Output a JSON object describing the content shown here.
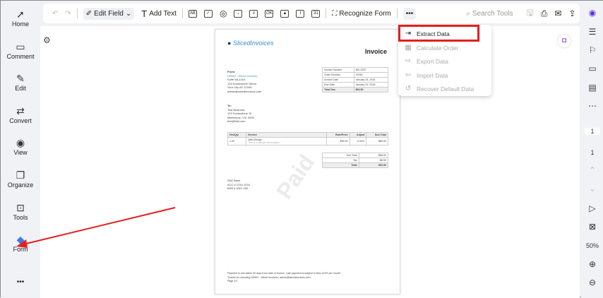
{
  "sidebar": {
    "items": [
      {
        "label": "Home",
        "icon": "rocket-icon"
      },
      {
        "label": "Comment",
        "icon": "comment-icon"
      },
      {
        "label": "Edit",
        "icon": "edit-icon"
      },
      {
        "label": "Convert",
        "icon": "convert-icon"
      },
      {
        "label": "View",
        "icon": "view-icon"
      },
      {
        "label": "Organize",
        "icon": "organize-icon"
      },
      {
        "label": "Tools",
        "icon": "toolbox-icon"
      },
      {
        "label": "Form",
        "icon": "form-icon"
      }
    ],
    "more": "•••"
  },
  "toolbar": {
    "edit_field": "Edit Field",
    "add_text": "Add Text",
    "recognize_form": "Recognize Form",
    "more": "•••",
    "search": "Search Tools",
    "ok_label": "OK",
    "date_label": "31",
    "text_field": "AB"
  },
  "dropdown": {
    "items": [
      "Extract Data",
      "Calculate Order",
      "Export Data",
      "Import Data",
      "Recover Default Data"
    ]
  },
  "document": {
    "brand": "SlicedInvoices",
    "title": "Invoice",
    "from_label": "From:",
    "from_lines": [
      "DEMO - Sliced Invoices",
      "Suite 5A-1204",
      "123 Somewhere Street",
      "Your City AZ 12345",
      "admin@slicedinvoices.com"
    ],
    "meta": [
      [
        "Invoice Number",
        "INV-3337"
      ],
      [
        "Order Number",
        "12345"
      ],
      [
        "Invoice Date",
        "January 25, 2016"
      ],
      [
        "Due Date",
        "January 31, 2016"
      ],
      [
        "Total Due",
        "$93.50"
      ]
    ],
    "to_label": "To:",
    "to_lines": [
      "Test Business",
      "123 Somewhere St",
      "Melbourne, VIC 3000",
      "test@test.com"
    ],
    "items_header": [
      "Hrs/Qty",
      "Service",
      "Rate/Price",
      "Adjust",
      "Sub Total"
    ],
    "items": [
      [
        "1.00",
        "Web Design",
        "$85.00",
        "0.00%",
        "$85.00"
      ]
    ],
    "item_desc": "This is a sample description...",
    "totals": [
      [
        "Sub Total",
        "$85.00"
      ],
      [
        "Tax",
        "$8.50"
      ],
      [
        "Total",
        "$93.50"
      ]
    ],
    "watermark": "Paid",
    "bank": [
      "ANZ Bank",
      "ACC # 1234 1234",
      "BSB # 4321 432"
    ],
    "footer": [
      "Payment is due within 30 days from date of invoice. Late payment is subject to fees of 5% per month.",
      "Thanks for choosing DEMO - Sliced Invoices | admin@slicedinvoices.com",
      "Page 1/1"
    ]
  },
  "rightbar": {
    "page_num": "1",
    "page_total": "1",
    "zoom": "50%"
  },
  "colors": {
    "highlight": "#e02020",
    "arrow": "#e02020"
  }
}
